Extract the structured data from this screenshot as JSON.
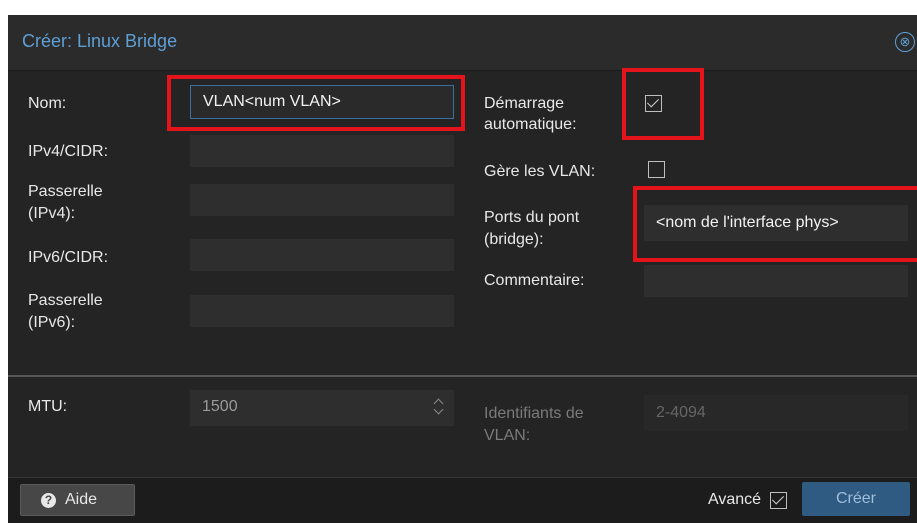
{
  "dialog": {
    "title": "Créer: Linux Bridge",
    "close_glyph": "⊗"
  },
  "left": {
    "name_label": "Nom:",
    "name_value": "VLAN<num VLAN>",
    "ipv4_label": "IPv4/CIDR:",
    "gw4_label_1": "Passerelle",
    "gw4_label_2": "(IPv4):",
    "ipv6_label": "IPv6/CIDR:",
    "gw6_label_1": "Passerelle",
    "gw6_label_2": "(IPv6):"
  },
  "right": {
    "autostart_label_1": "Démarrage",
    "autostart_label_2": "automatique:",
    "autostart_checked": true,
    "vlan_aware_label": "Gère les VLAN:",
    "vlan_aware_checked": false,
    "ports_label_1": "Ports du pont",
    "ports_label_2": "(bridge):",
    "ports_value": "<nom de l'interface phys>",
    "comment_label": "Commentaire:"
  },
  "advanced": {
    "mtu_label": "MTU:",
    "mtu_value": "1500",
    "vlan_ids_label_1": "Identifiants de",
    "vlan_ids_label_2": "VLAN:",
    "vlan_ids_placeholder": "2-4094"
  },
  "footer": {
    "help_label": "Aide",
    "help_icon": "question-circle-icon",
    "advanced_label": "Avancé",
    "advanced_checked": true,
    "create_label": "Créer"
  },
  "colors": {
    "accent": "#5e9fd6",
    "highlight": "#e5141b",
    "background": "#242424"
  }
}
